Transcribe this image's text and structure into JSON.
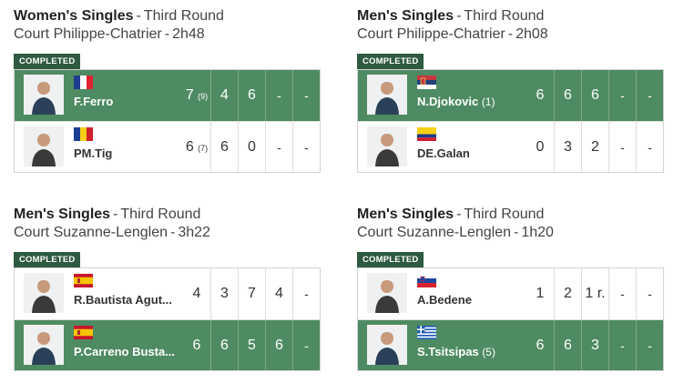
{
  "status_label": "COMPLETED",
  "matches": [
    {
      "event": "Women's Singles",
      "round": "Third Round",
      "court": "Court Philippe-Chatrier",
      "duration": "2h48",
      "players": [
        {
          "name": "F.Ferro",
          "seed": "",
          "country": "France",
          "flag_icon": "france-flag-icon",
          "winner": true,
          "sets": [
            {
              "s": "7",
              "tb": "(9)"
            },
            {
              "s": "4",
              "tb": ""
            },
            {
              "s": "6",
              "tb": ""
            },
            {
              "s": "-",
              "tb": ""
            },
            {
              "s": "-",
              "tb": ""
            }
          ]
        },
        {
          "name": "PM.Tig",
          "seed": "",
          "country": "Romania",
          "flag_icon": "romania-flag-icon",
          "winner": false,
          "sets": [
            {
              "s": "6",
              "tb": "(7)"
            },
            {
              "s": "6",
              "tb": ""
            },
            {
              "s": "0",
              "tb": ""
            },
            {
              "s": "-",
              "tb": ""
            },
            {
              "s": "-",
              "tb": ""
            }
          ]
        }
      ]
    },
    {
      "event": "Men's Singles",
      "round": "Third Round",
      "court": "Court Philippe-Chatrier",
      "duration": "2h08",
      "players": [
        {
          "name": "N.Djokovic",
          "seed": "(1)",
          "country": "Serbia",
          "flag_icon": "serbia-flag-icon",
          "winner": true,
          "sets": [
            {
              "s": "6",
              "tb": ""
            },
            {
              "s": "6",
              "tb": ""
            },
            {
              "s": "6",
              "tb": ""
            },
            {
              "s": "-",
              "tb": ""
            },
            {
              "s": "-",
              "tb": ""
            }
          ]
        },
        {
          "name": "DE.Galan",
          "seed": "",
          "country": "Colombia",
          "flag_icon": "colombia-flag-icon",
          "winner": false,
          "sets": [
            {
              "s": "0",
              "tb": ""
            },
            {
              "s": "3",
              "tb": ""
            },
            {
              "s": "2",
              "tb": ""
            },
            {
              "s": "-",
              "tb": ""
            },
            {
              "s": "-",
              "tb": ""
            }
          ]
        }
      ]
    },
    {
      "event": "Men's Singles",
      "round": "Third Round",
      "court": "Court Suzanne-Lenglen",
      "duration": "3h22",
      "players": [
        {
          "name": "R.Bautista Agut...",
          "seed": "",
          "country": "Spain",
          "flag_icon": "spain-flag-icon",
          "winner": false,
          "sets": [
            {
              "s": "4",
              "tb": ""
            },
            {
              "s": "3",
              "tb": ""
            },
            {
              "s": "7",
              "tb": ""
            },
            {
              "s": "4",
              "tb": ""
            },
            {
              "s": "-",
              "tb": ""
            }
          ]
        },
        {
          "name": "P.Carreno Busta...",
          "seed": "",
          "country": "Spain",
          "flag_icon": "spain-flag-icon",
          "winner": true,
          "sets": [
            {
              "s": "6",
              "tb": ""
            },
            {
              "s": "6",
              "tb": ""
            },
            {
              "s": "5",
              "tb": ""
            },
            {
              "s": "6",
              "tb": ""
            },
            {
              "s": "-",
              "tb": ""
            }
          ]
        }
      ]
    },
    {
      "event": "Men's Singles",
      "round": "Third Round",
      "court": "Court Suzanne-Lenglen",
      "duration": "1h20",
      "players": [
        {
          "name": "A.Bedene",
          "seed": "",
          "country": "Slovenia",
          "flag_icon": "slovenia-flag-icon",
          "winner": false,
          "sets": [
            {
              "s": "1",
              "tb": ""
            },
            {
              "s": "2",
              "tb": ""
            },
            {
              "s": "1 r.",
              "tb": ""
            },
            {
              "s": "-",
              "tb": ""
            },
            {
              "s": "-",
              "tb": ""
            }
          ]
        },
        {
          "name": "S.Tsitsipas",
          "seed": "(5)",
          "country": "Greece",
          "flag_icon": "greece-flag-icon",
          "winner": true,
          "sets": [
            {
              "s": "6",
              "tb": ""
            },
            {
              "s": "6",
              "tb": ""
            },
            {
              "s": "3",
              "tb": ""
            },
            {
              "s": "-",
              "tb": ""
            },
            {
              "s": "-",
              "tb": ""
            }
          ]
        }
      ]
    }
  ],
  "colors": {
    "winner_row": "#4f8b62",
    "badge": "#2e5a3f",
    "loser_row": "#ffffff"
  }
}
